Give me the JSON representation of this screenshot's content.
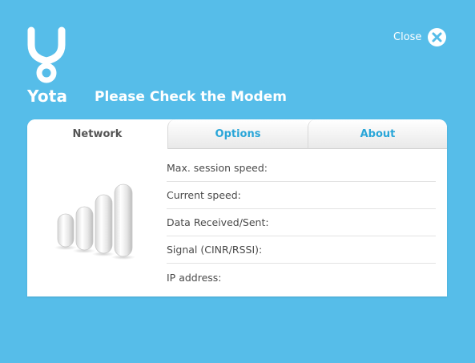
{
  "brand": {
    "name": "Yota"
  },
  "header": {
    "title": "Please Check the Modem"
  },
  "close": {
    "label": "Close"
  },
  "tabs": [
    {
      "label": "Network",
      "active": true
    },
    {
      "label": "Options",
      "active": false
    },
    {
      "label": "About",
      "active": false
    }
  ],
  "network": {
    "fields": [
      {
        "label": "Max. session speed:",
        "value": ""
      },
      {
        "label": "Current speed:",
        "value": ""
      },
      {
        "label": "Data Received/Sent:",
        "value": ""
      },
      {
        "label": "Signal (CINR/RSSI):",
        "value": ""
      },
      {
        "label": "IP address:",
        "value": ""
      }
    ]
  },
  "icons": {
    "logo": "yota-logo-icon",
    "close": "close-icon",
    "signal": "signal-bars-icon"
  },
  "colors": {
    "background": "#56bde9",
    "accent": "#2aa6d8",
    "panel": "#ffffff"
  }
}
